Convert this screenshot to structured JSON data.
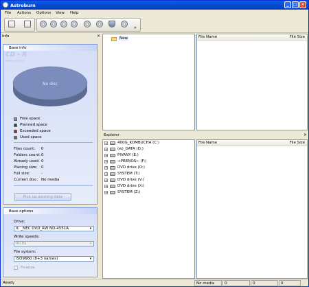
{
  "window": {
    "title": "Astroburn"
  },
  "menu": [
    "File",
    "Actions",
    "Options",
    "View",
    "Help"
  ],
  "toolbar": {
    "items": [
      {
        "icon": "new-project-icon"
      },
      {
        "icon": "open-image-icon"
      },
      {
        "icon": "burn-disc-icon"
      },
      {
        "icon": "copy-disc-icon"
      },
      {
        "icon": "save-image-icon"
      },
      {
        "icon": "erase-disc-icon"
      },
      {
        "icon": "radiation-icon"
      },
      {
        "icon": "disc-settings-icon"
      },
      {
        "icon": "shield-icon"
      },
      {
        "icon": "media-info-icon"
      }
    ],
    "overflow": "»"
  },
  "info_panel": {
    "title": "Info",
    "close": "×",
    "base_info": {
      "title": "Base info",
      "watermark": "CD - R",
      "watermark_url": "www.cdr.cz",
      "disc_label": "No disc",
      "legend": [
        {
          "label": "Free space",
          "color": "#7c8dbd"
        },
        {
          "label": "Planned space",
          "color": "#2a4690"
        },
        {
          "label": "Exceeded space",
          "color": "#b32020"
        },
        {
          "label": "Used space",
          "color": "#5f6f9a"
        }
      ],
      "stats": [
        {
          "label": "Files count:",
          "value": "0"
        },
        {
          "label": "Folders count:",
          "value": "0"
        },
        {
          "label": "Already used:",
          "value": "0"
        },
        {
          "label": "Planing size:",
          "value": "0"
        },
        {
          "label": "Full size:",
          "value": "-"
        },
        {
          "label": "Current disc:",
          "value": "No media"
        }
      ],
      "pickup_button": "Pick up existing data"
    },
    "base_options": {
      "title": "Base options",
      "drive_label": "Drive:",
      "drive_value": "X: _NEC   DVD_RW ND-4551A",
      "speed_label": "Write speeds:",
      "speed_value": "40.0x",
      "fs_label": "File system:",
      "fs_value": "ISO9660 (8+3 names)",
      "finalize_label": "Finalize"
    }
  },
  "project_tree": {
    "root_label": "New"
  },
  "project_list": {
    "col_name": "File Name",
    "col_size": "File Size"
  },
  "explorer": {
    "title": "Explorer",
    "close": "×",
    "drives": [
      "400G_KOMBUCHA (C:)",
      "(w)_DATA (D:)",
      "PIVANY (E:)",
      "→PRENOS←  (F:)",
      "DVD drive (O:)",
      "SYSTEM (T:)",
      "DVD drive (V:)",
      "DVD drive (X:)",
      "SYSTEM (Z:)"
    ],
    "col_name": "File Name",
    "col_size": "File Size"
  },
  "statusbar": {
    "status": "Ready",
    "media": "No media",
    "val1": "0",
    "val2": "0",
    "val3": "0"
  }
}
